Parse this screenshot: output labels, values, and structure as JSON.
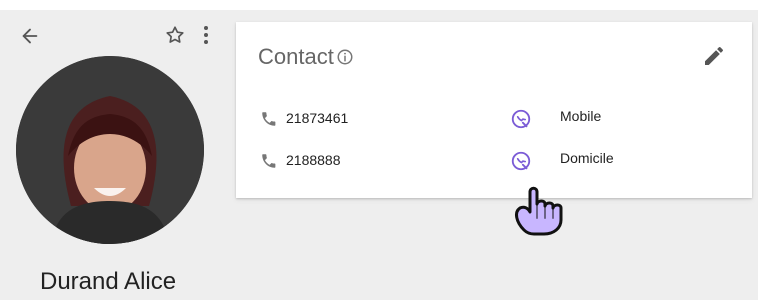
{
  "header": {
    "back_icon": "arrow-left-icon",
    "star_icon": "star-outline-icon",
    "more_icon": "more-vert-icon"
  },
  "profile": {
    "name": "Durand Alice",
    "avatar_icon": "profile-photo"
  },
  "contact": {
    "title": "Contact",
    "info_icon": "info-icon",
    "edit_icon": "pencil-icon",
    "rows": [
      {
        "number": "21873461",
        "type": "Mobile",
        "phone_icon": "phone-icon",
        "type_icon": "phone-type-icon"
      },
      {
        "number": "2188888",
        "type": "Domicile",
        "phone_icon": "phone-icon",
        "type_icon": "phone-type-icon"
      }
    ]
  },
  "colors": {
    "accent_purple": "#7b5cd6",
    "icon_gray": "#777777",
    "background": "#eeeeee"
  },
  "cursor": {
    "icon": "hand-pointer-icon"
  }
}
